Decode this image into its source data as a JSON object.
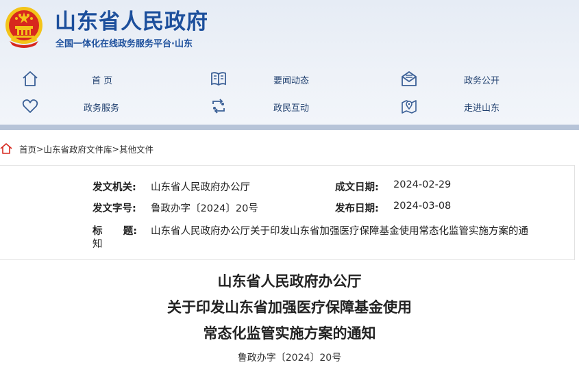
{
  "header": {
    "title": "山东省人民政府",
    "subtitle": "全国一体化在线政务服务平台·山东"
  },
  "nav": {
    "items": [
      {
        "label": "首  页",
        "icon": "home-icon"
      },
      {
        "label": "要闻动态",
        "icon": "book-icon"
      },
      {
        "label": "政务公开",
        "icon": "mail-icon"
      },
      {
        "label": "政务服务",
        "icon": "heart-icon"
      },
      {
        "label": "政民互动",
        "icon": "exchange-icon"
      },
      {
        "label": "走进山东",
        "icon": "map-pin-icon"
      }
    ]
  },
  "breadcrumb": {
    "items": [
      "首页",
      "山东省政府文件库",
      "其他文件"
    ],
    "separator": ">"
  },
  "meta": {
    "issuer_label": "发文机关:",
    "issuer": "山东省人民政府办公厅",
    "date_label": "成文日期:",
    "date": "2024-02-29",
    "doc_no_label": "发文字号:",
    "doc_no": "鲁政办字〔2024〕20号",
    "publish_label": "发布日期:",
    "publish": "2024-03-08",
    "title_label": "标      题:",
    "title_line1": "山东省人民政府办公厅关于印发山东省加强医疗保障基金使用常态化监管实施方案的通",
    "title_line2": "知"
  },
  "document": {
    "line1": "山东省人民政府办公厅",
    "line2": "关于印发山东省加强医疗保障基金使用",
    "line3": "常态化监管实施方案的通知",
    "number": "鲁政办字〔2024〕20号"
  },
  "colors": {
    "brand": "#1c4f9c",
    "nav_icon": "#3a5f96",
    "header_bg": "#e9eef6",
    "header_bar": "#b7c4d8",
    "emblem_red": "#d7281e",
    "emblem_gold": "#f3c419"
  }
}
